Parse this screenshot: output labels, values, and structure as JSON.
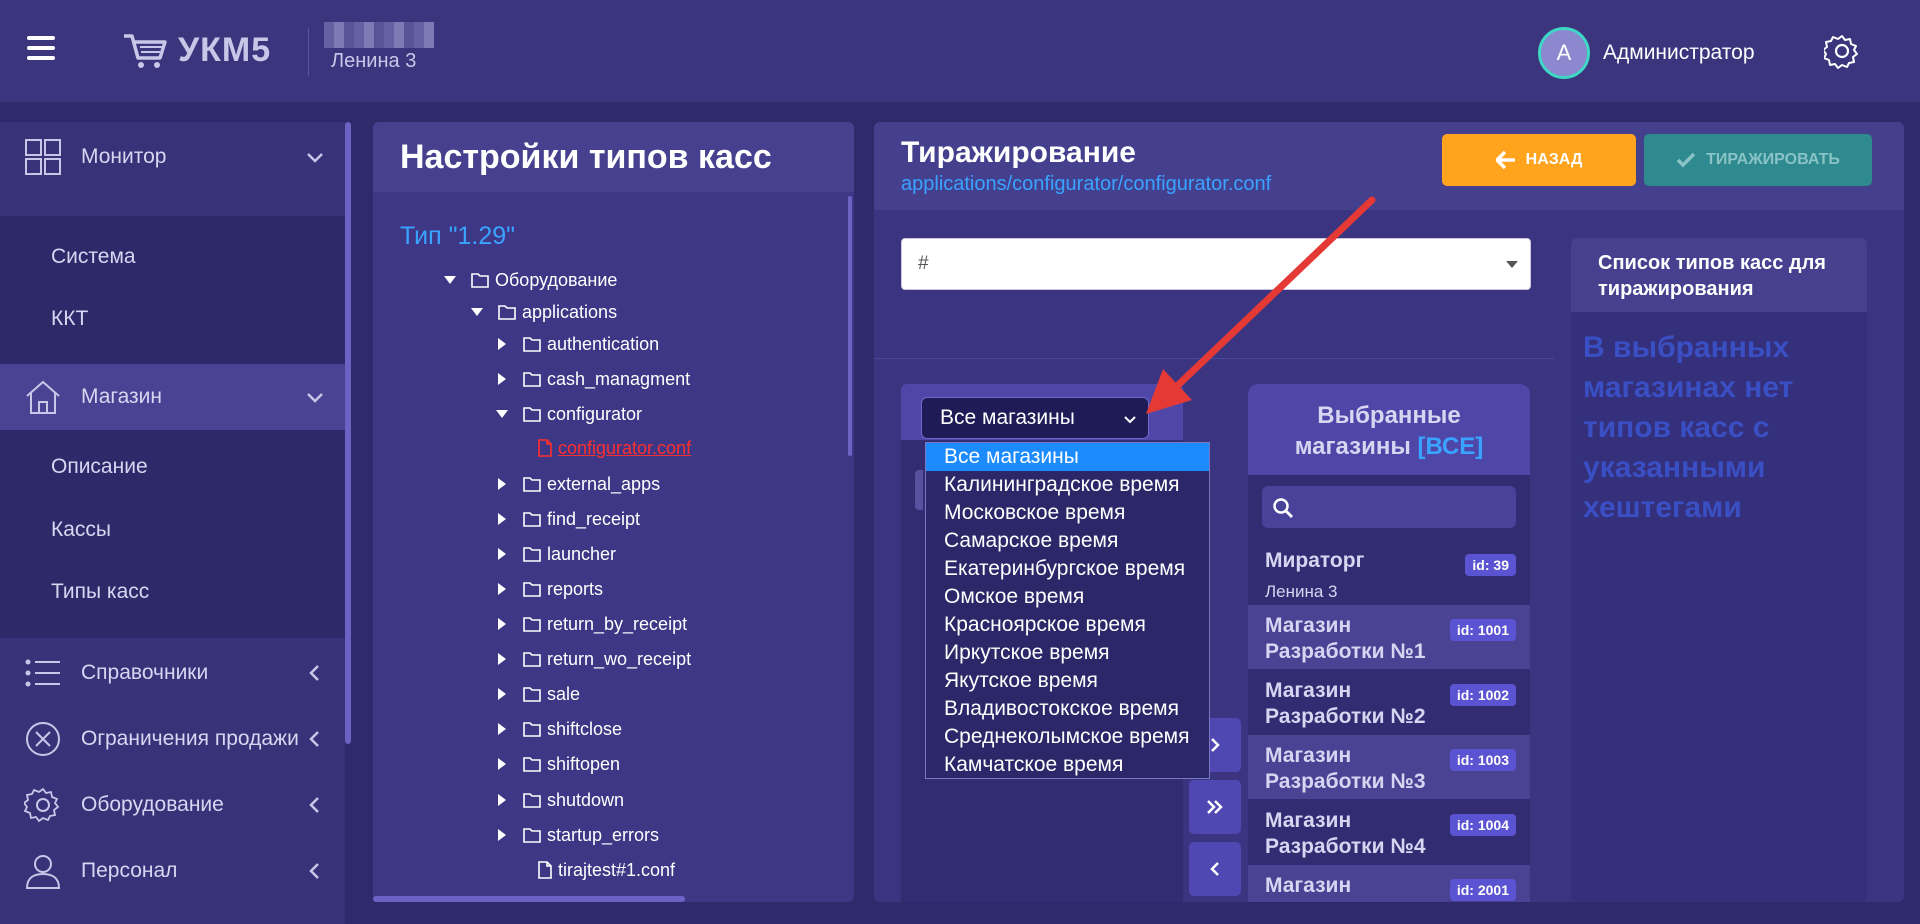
{
  "header": {
    "logo_text": "УКМ5",
    "store_name": "Ленина 3",
    "avatar_letter": "А",
    "user_name": "Администратор"
  },
  "sidebar": {
    "items": [
      {
        "label": "Монитор",
        "icon": "grid-icon"
      },
      {
        "label": "Магазин",
        "icon": "home-icon"
      },
      {
        "label": "Справочники",
        "icon": "list-icon"
      },
      {
        "label": "Ограничения продажи",
        "icon": "ban-icon"
      },
      {
        "label": "Оборудование",
        "icon": "gear-icon"
      },
      {
        "label": "Персонал",
        "icon": "user-icon"
      }
    ],
    "monitor_sub": [
      "Система",
      "ККТ"
    ],
    "store_sub": [
      "Описание",
      "Кассы",
      "Типы касс"
    ]
  },
  "tree": {
    "title": "Настройки типов касс",
    "type_label": "Тип \"1.29\"",
    "nodes": [
      {
        "label": "Оборудование",
        "kind": "folder",
        "state": "open"
      },
      {
        "label": "applications",
        "kind": "folder",
        "state": "open"
      },
      {
        "label": "authentication",
        "kind": "folder",
        "state": "closed"
      },
      {
        "label": "cash_managment",
        "kind": "folder",
        "state": "closed"
      },
      {
        "label": "configurator",
        "kind": "folder",
        "state": "open"
      },
      {
        "label": "configurator.conf",
        "kind": "file",
        "state": "selected"
      },
      {
        "label": "external_apps",
        "kind": "folder",
        "state": "closed"
      },
      {
        "label": "find_receipt",
        "kind": "folder",
        "state": "closed"
      },
      {
        "label": "launcher",
        "kind": "folder",
        "state": "closed"
      },
      {
        "label": "reports",
        "kind": "folder",
        "state": "closed"
      },
      {
        "label": "return_by_receipt",
        "kind": "folder",
        "state": "closed"
      },
      {
        "label": "return_wo_receipt",
        "kind": "folder",
        "state": "closed"
      },
      {
        "label": "sale",
        "kind": "folder",
        "state": "closed"
      },
      {
        "label": "shiftclose",
        "kind": "folder",
        "state": "closed"
      },
      {
        "label": "shiftopen",
        "kind": "folder",
        "state": "closed"
      },
      {
        "label": "shutdown",
        "kind": "folder",
        "state": "closed"
      },
      {
        "label": "startup_errors",
        "kind": "folder",
        "state": "closed"
      },
      {
        "label": "tirajtest#1.conf",
        "kind": "file",
        "state": "normal"
      }
    ]
  },
  "replication": {
    "title": "Тиражирование",
    "path": "applications/configurator/configurator.conf",
    "back_label": "НАЗАД",
    "replicate_label": "ТИРАЖИРОВАТЬ",
    "hashtag_value": "#",
    "filter_value": "Все магазины",
    "filter_options": [
      "Все магазины",
      "Калининградское время",
      "Московское время",
      "Самарское время",
      "Екатеринбургское время",
      "Омское время",
      "Красноярское время",
      "Иркутское время",
      "Якутское время",
      "Владивостокское время",
      "Среднеколымское время",
      "Камчатское время"
    ],
    "selected_title_line1": "Выбранные",
    "selected_title_line2": "магазины",
    "selected_all": "[ВСЕ]",
    "stores": [
      {
        "name": "Мираторг",
        "sub": "Ленина 3",
        "id": "id: 39"
      },
      {
        "name": "Магазин Разработки №1",
        "sub": "",
        "id": "id: 1001"
      },
      {
        "name": "Магазин Разработки №2",
        "sub": "",
        "id": "id: 1002"
      },
      {
        "name": "Магазин Разработки №3",
        "sub": "",
        "id": "id: 1003"
      },
      {
        "name": "Магазин Разработки №4",
        "sub": "",
        "id": "id: 1004"
      },
      {
        "name": "Магазин Аналитики",
        "sub": "",
        "id": "id: 2001"
      }
    ],
    "types_title": "Список типов касс для тиражирования",
    "types_empty": "В выбранных магазинах нет типов касс с указанными хештегами"
  },
  "colors": {
    "background": "#2f2a6b",
    "accent_blue": "#3aa3ff",
    "back_button": "#ffa41c",
    "replicate_button": "#2f8a90",
    "selected_option": "#1b8bff",
    "arrow": "#e53935"
  }
}
